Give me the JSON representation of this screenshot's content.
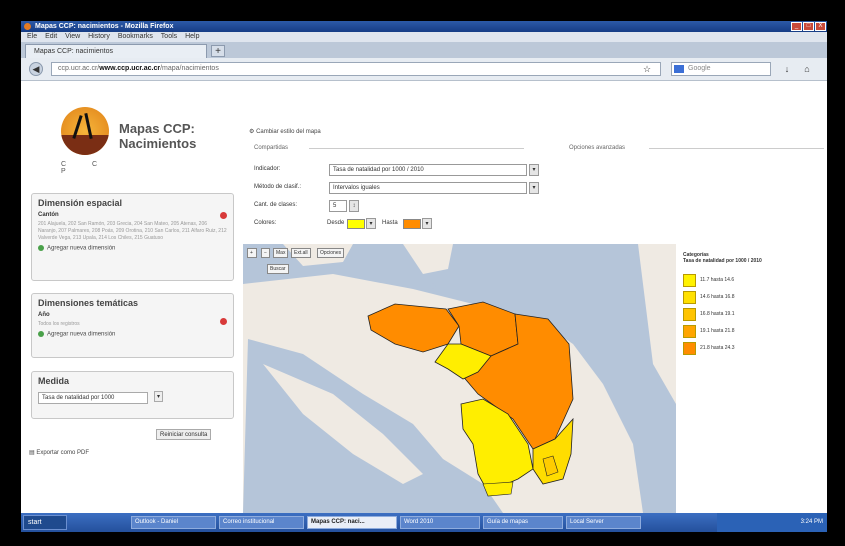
{
  "window": {
    "title": "Mapas CCP: nacimientos - Mozilla Firefox",
    "controls": [
      "_",
      "□",
      "X"
    ]
  },
  "menu": [
    "Ele",
    "Edit",
    "View",
    "History",
    "Bookmarks",
    "Tools",
    "Help"
  ],
  "tab": {
    "label": "Mapas CCP: nacimientos",
    "new_tab": "+"
  },
  "address": {
    "prefix": "ccp.ucr.ac.cr/",
    "host": "www.ccp.ucr.ac.cr",
    "path": "/mapa/nacimientos"
  },
  "search": {
    "placeholder": "Google"
  },
  "app": {
    "title_line1": "Mapas CCP:",
    "title_line2": "Nacimientos",
    "logo_marks": "C C P"
  },
  "sidebar": {
    "espacial": {
      "title": "Dimensión espacial",
      "selected": "Cantón",
      "description": "201 Alajuela, 202 San Ramón, 203 Grecia, 204 San Mateo, 205 Atenas, 206 Naranjo, 207 Palmares, 208 Poás, 209 Orotina, 210 San Carlos, 211 Alfaro Ruiz, 212 Valverde Vega, 213 Upala, 214 Los Chiles, 215 Guatuso",
      "add": "Agregar nueva dimensión"
    },
    "tematicas": {
      "title": "Dimensiones temáticas",
      "selected": "Año",
      "description": "Todos los registros",
      "add": "Agregar nueva dimensión"
    },
    "medida": {
      "title": "Medida",
      "value": "Tasa de natalidad por 1000"
    },
    "reset_button": "Reiniciar consulta",
    "export": "Exportar como PDF"
  },
  "form": {
    "toggle_link": "Cambiar estilo del mapa",
    "section_basic": "Compartidas",
    "section_advanced": "Opciones avanzadas",
    "indicator_label": "Indicador:",
    "indicator_value": "Tasa de natalidad por 1000 / 2010",
    "method_label": "Método de clasif.:",
    "method_value": "Intervalos iguales",
    "classes_label": "Cant. de clases:",
    "classes_value": "5",
    "colors_label": "Colores:",
    "color_start_label": "Desde",
    "color_end_label": "Hasta",
    "color_start": "#ffff00",
    "color_end": "#ff8c00"
  },
  "map_tools": {
    "zoom_in": "+",
    "zoom_out": "−",
    "pan": "Max",
    "full": "Ext.all",
    "select": "Opciones",
    "search": "Buscar"
  },
  "legend": {
    "title_line1": "Categorías",
    "title_line2": "Tasa de natalidad por 1000 / 2010",
    "items": [
      {
        "label": "11.7  hasta  14.6",
        "color": "#fff200"
      },
      {
        "label": "14.6  hasta  16.8",
        "color": "#ffe000"
      },
      {
        "label": "16.8  hasta  19.1",
        "color": "#ffc400"
      },
      {
        "label": "19.1  hasta  21.8",
        "color": "#ffa500"
      },
      {
        "label": "21.8  hasta  24.3",
        "color": "#ff8c00"
      }
    ]
  },
  "taskbar": {
    "start": "start",
    "tasks": [
      "Outlook - Daniel",
      "Correo institucional",
      "Mapas CCP: naci...",
      "Word 2010",
      "Guía de mapas",
      "Local Server"
    ],
    "clock": "3:24 PM"
  }
}
